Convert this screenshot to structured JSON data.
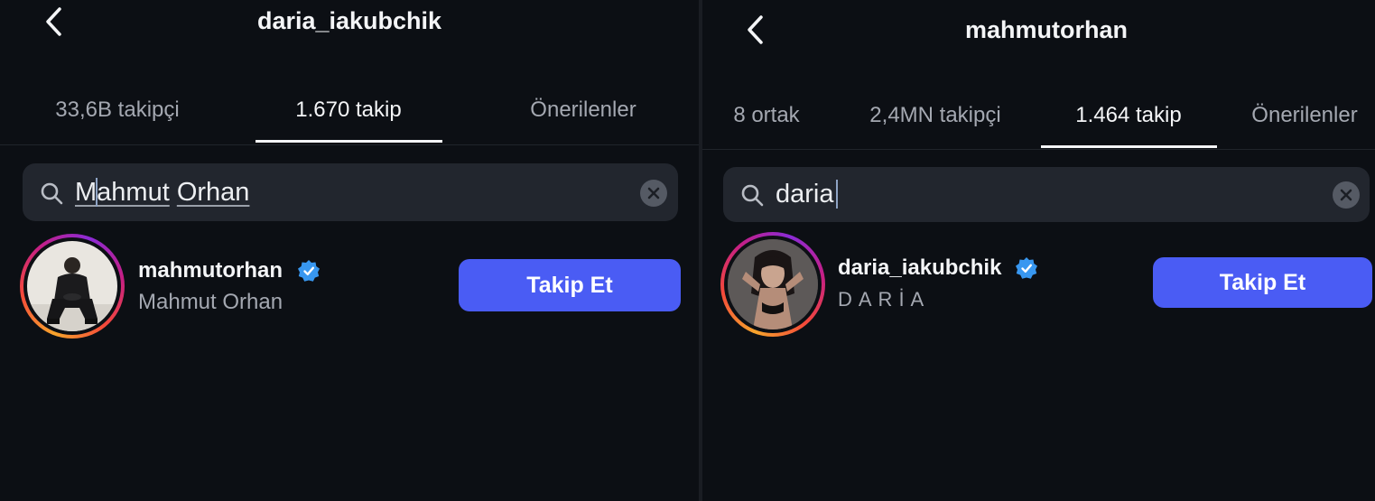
{
  "left": {
    "title": "daria_iakubchik",
    "tabs": [
      {
        "label": "33,6B takipçi",
        "active": false
      },
      {
        "label": "1.670 takip",
        "active": true
      },
      {
        "label": "Önerilenler",
        "active": false
      }
    ],
    "search": {
      "query_parts": [
        "Mahmut",
        " ",
        "Orhan"
      ]
    },
    "result": {
      "username": "mahmutorhan",
      "verified": true,
      "full_name": "Mahmut Orhan",
      "button": "Takip Et",
      "avatar_icon": "man-sitting-photo-avatar"
    }
  },
  "right": {
    "title": "mahmutorhan",
    "tabs": [
      {
        "label": "8 ortak",
        "active": false
      },
      {
        "label": "2,4MN takipçi",
        "active": false
      },
      {
        "label": "1.464 takip",
        "active": true
      },
      {
        "label": "Önerilenler",
        "active": false
      }
    ],
    "search": {
      "query": "daria"
    },
    "result": {
      "username": "daria_iakubchik",
      "verified": true,
      "full_name": "DARİA",
      "button": "Takip Et",
      "avatar_icon": "woman-portrait-photo-avatar"
    }
  },
  "colors": {
    "background": "#0c0f14",
    "search_bg": "#22262e",
    "follow_button": "#4a5cf4",
    "verified": "#3897f0",
    "muted_text": "#a4a8b1"
  }
}
